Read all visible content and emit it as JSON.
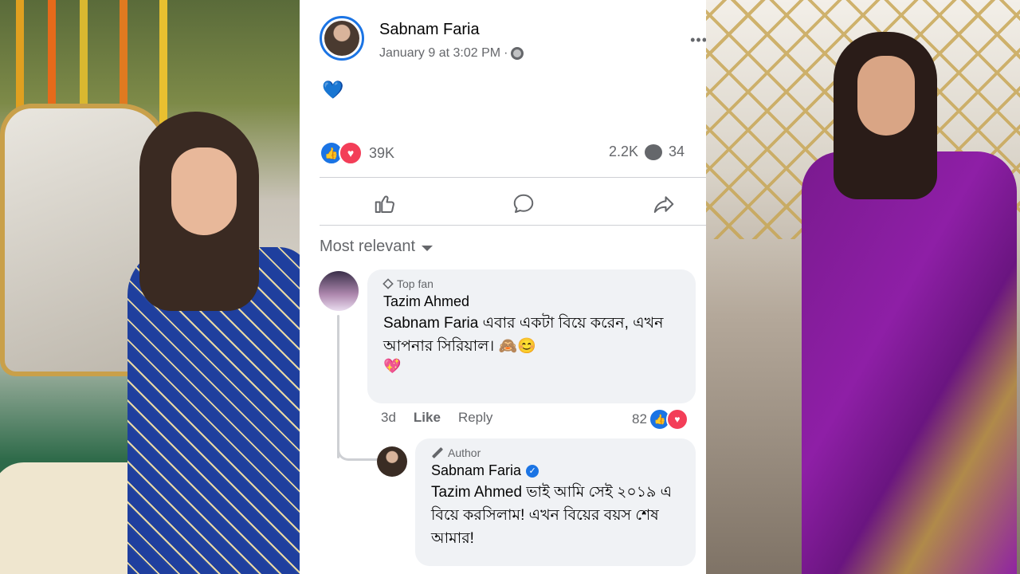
{
  "post": {
    "author": "Sabnam Faria",
    "timestamp": "January 9 at 3:02 PM",
    "separator": "·",
    "audience_icon": "globe-icon",
    "content_emoji": "💙",
    "reaction_count": "39K",
    "comment_count": "2.2K",
    "share_count": "34",
    "more_icon": "•••"
  },
  "actions": {
    "like_icon": "thumbs-up-icon",
    "comment_icon": "comment-icon",
    "share_icon": "share-icon"
  },
  "sort": {
    "label": "Most relevant"
  },
  "comments": [
    {
      "badge": "Top fan",
      "name": "Tazim Ahmed",
      "text": "Sabnam Faria এবার একটা বিয়ে করেন, এখন আপনার সিরিয়াল। 🙈😊",
      "emoji": "💖",
      "age": "3d",
      "like_label": "Like",
      "reply_label": "Reply",
      "reaction_count": "82"
    },
    {
      "badge": "Author",
      "name": "Sabnam Faria",
      "verified": "✓",
      "text": "Tazim Ahmed ভাই আমি সেই ২০১৯ এ বিয়ে করসিলাম! এখন বিয়ের বয়স শেষ আমার!"
    }
  ],
  "colors": {
    "accent": "#1b74e4",
    "love": "#f33e58",
    "muted": "#65676b",
    "bubble": "#f0f2f5"
  }
}
